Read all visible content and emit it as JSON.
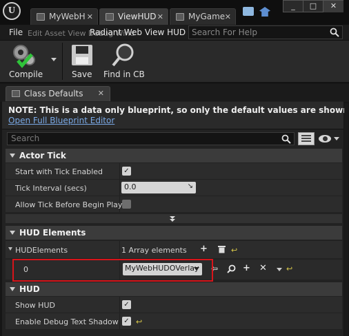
{
  "window": {
    "tabs": [
      {
        "label": "MyWebH",
        "active": false
      },
      {
        "label": "ViewHUD",
        "active": true
      },
      {
        "label": "MyGame",
        "active": false
      }
    ],
    "controls": {
      "minimize": "_",
      "maximize": "□",
      "close": "✕"
    },
    "logo_letter": "U"
  },
  "menubar": {
    "file": "File",
    "edit": "Edit",
    "asset": "Asset",
    "view": "View",
    "debug": "Debug",
    "window": "Wind",
    "ghost_text": "Edit  Asset  View  Debug  Wind",
    "overlay_text": "Radiant Web View HUD",
    "search_placeholder": "Search For Help"
  },
  "toolbar": {
    "compile": "Compile",
    "save": "Save",
    "find": "Find in CB"
  },
  "panel": {
    "tab_label": "Class Defaults",
    "note": "NOTE: This is a data only blueprint, so only the default values are shown.  It does not have",
    "open_link": "Open Full Blueprint Editor",
    "search_placeholder": "Search"
  },
  "actor_tick": {
    "title": "Actor Tick",
    "start_label": "Start with Tick Enabled",
    "start_checked": true,
    "interval_label": "Tick Interval (secs)",
    "interval_value": "0.0",
    "allow_label": "Allow Tick Before Begin Play",
    "allow_checked": false
  },
  "hud_elements": {
    "title": "HUD Elements",
    "array_label": "HUDElements",
    "array_summary": "1 Array elements",
    "index": "0",
    "element_value": "MyWebHUDOVerlay"
  },
  "hud": {
    "title": "HUD",
    "show_label": "Show HUD",
    "show_checked": true,
    "debug_label": "Enable Debug Text Shadow",
    "debug_checked": true
  },
  "colors": {
    "accent_link": "#7aa9e6",
    "highlight_box": "#d8141a",
    "reset_arrow": "#d8c84a"
  }
}
